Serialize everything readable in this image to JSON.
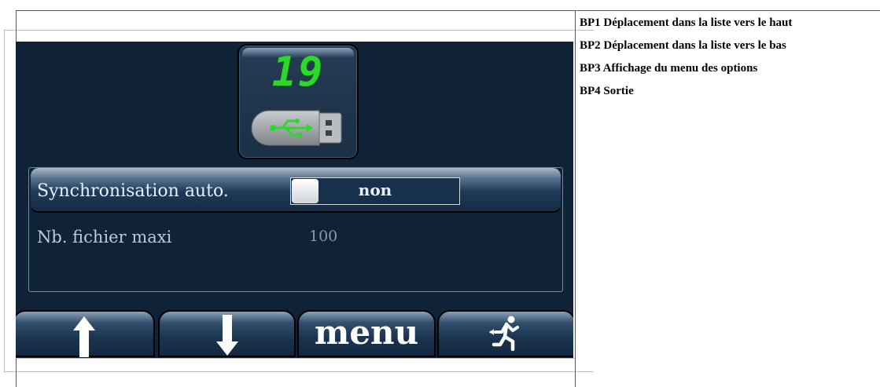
{
  "display": {
    "file_counter": "19",
    "icons": {
      "storage": "usb-stick-icon"
    }
  },
  "settings": {
    "sync_auto": {
      "label": "Synchronisation auto.",
      "value": "non"
    },
    "max_files": {
      "label": "Nb. fichier maxi",
      "value": "100"
    }
  },
  "buttons": {
    "bp1": {
      "icon": "arrow-up-icon"
    },
    "bp2": {
      "icon": "arrow-down-icon"
    },
    "bp3": {
      "label": "menu"
    },
    "bp4": {
      "icon": "exit-icon"
    }
  },
  "legend": [
    "BP1 Déplacement dans la liste vers le haut",
    "BP2 Déplacement dans la liste vers le bas",
    "BP3 Affichage du menu des options",
    "BP4 Sortie"
  ],
  "colors": {
    "screen_bg": "#0f2236",
    "counter_digits": "#2bd92b",
    "usb_symbol": "#2bd92b"
  }
}
